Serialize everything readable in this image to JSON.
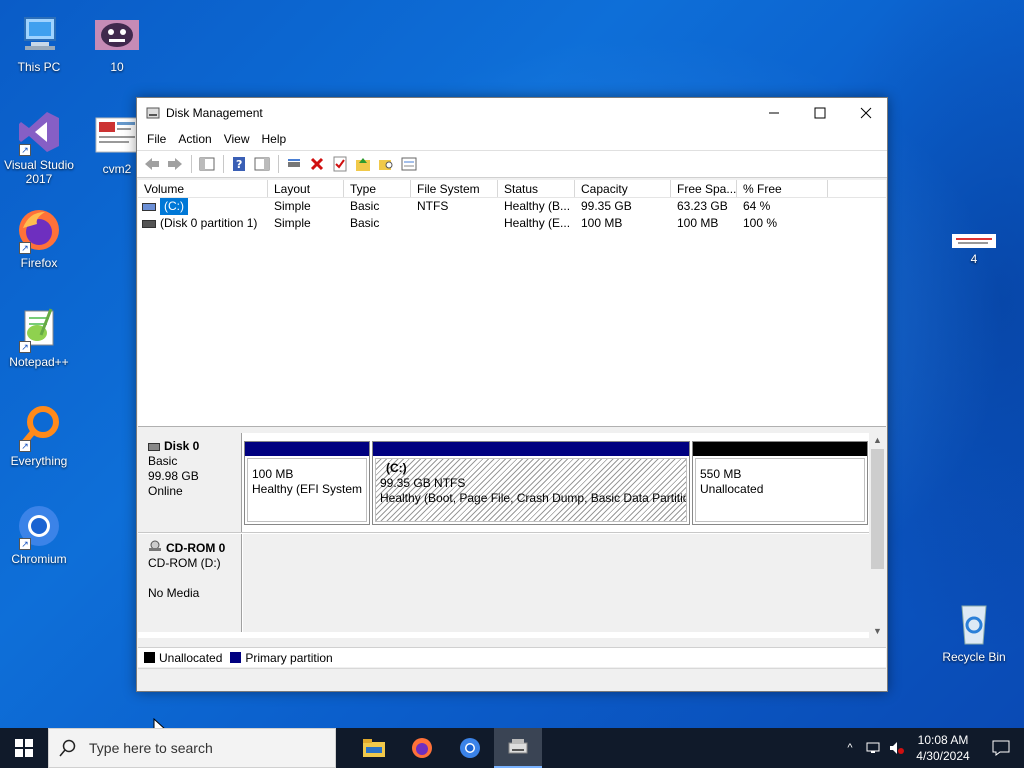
{
  "desktop": {
    "icons": [
      {
        "label": "This PC"
      },
      {
        "label": "10"
      },
      {
        "label": "Visual Studio 2017"
      },
      {
        "label": "cvm2"
      },
      {
        "label": "Firefox"
      },
      {
        "label": "Notepad++"
      },
      {
        "label": "Everything"
      },
      {
        "label": "Chromium"
      },
      {
        "label": "4"
      },
      {
        "label": "Recycle Bin"
      }
    ]
  },
  "window": {
    "title": "Disk Management",
    "menu": [
      "File",
      "Action",
      "View",
      "Help"
    ]
  },
  "volumes": {
    "columns": [
      "Volume",
      "Layout",
      "Type",
      "File System",
      "Status",
      "Capacity",
      "Free Spa...",
      "% Free"
    ],
    "rows": [
      {
        "volume": "(C:)",
        "layout": "Simple",
        "type": "Basic",
        "fs": "NTFS",
        "status": "Healthy (B...",
        "capacity": "99.35 GB",
        "free": "63.23 GB",
        "pct": "64 %"
      },
      {
        "volume": "(Disk 0 partition 1)",
        "layout": "Simple",
        "type": "Basic",
        "fs": "",
        "status": "Healthy (E...",
        "capacity": "100 MB",
        "free": "100 MB",
        "pct": "100 %"
      }
    ]
  },
  "disks": {
    "disk0": {
      "name": "Disk 0",
      "type": "Basic",
      "size": "99.98 GB",
      "state": "Online",
      "partitions": [
        {
          "line1": "100 MB",
          "line2": "Healthy (EFI System P"
        },
        {
          "title": "(C:)",
          "line1": "99.35 GB NTFS",
          "line2": "Healthy (Boot, Page File, Crash Dump, Basic Data Partitior"
        },
        {
          "line1": "550 MB",
          "line2": "Unallocated"
        }
      ]
    },
    "cdrom0": {
      "name": "CD-ROM 0",
      "type": "CD-ROM (D:)",
      "media": "No Media"
    }
  },
  "legend": {
    "unallocated": "Unallocated",
    "primary": "Primary partition"
  },
  "colors": {
    "primary": "#000080",
    "unallocated": "#000000",
    "selection": "#0078d7"
  },
  "taskbar": {
    "search_placeholder": "Type here to search",
    "time": "10:08 AM",
    "date": "4/30/2024"
  }
}
